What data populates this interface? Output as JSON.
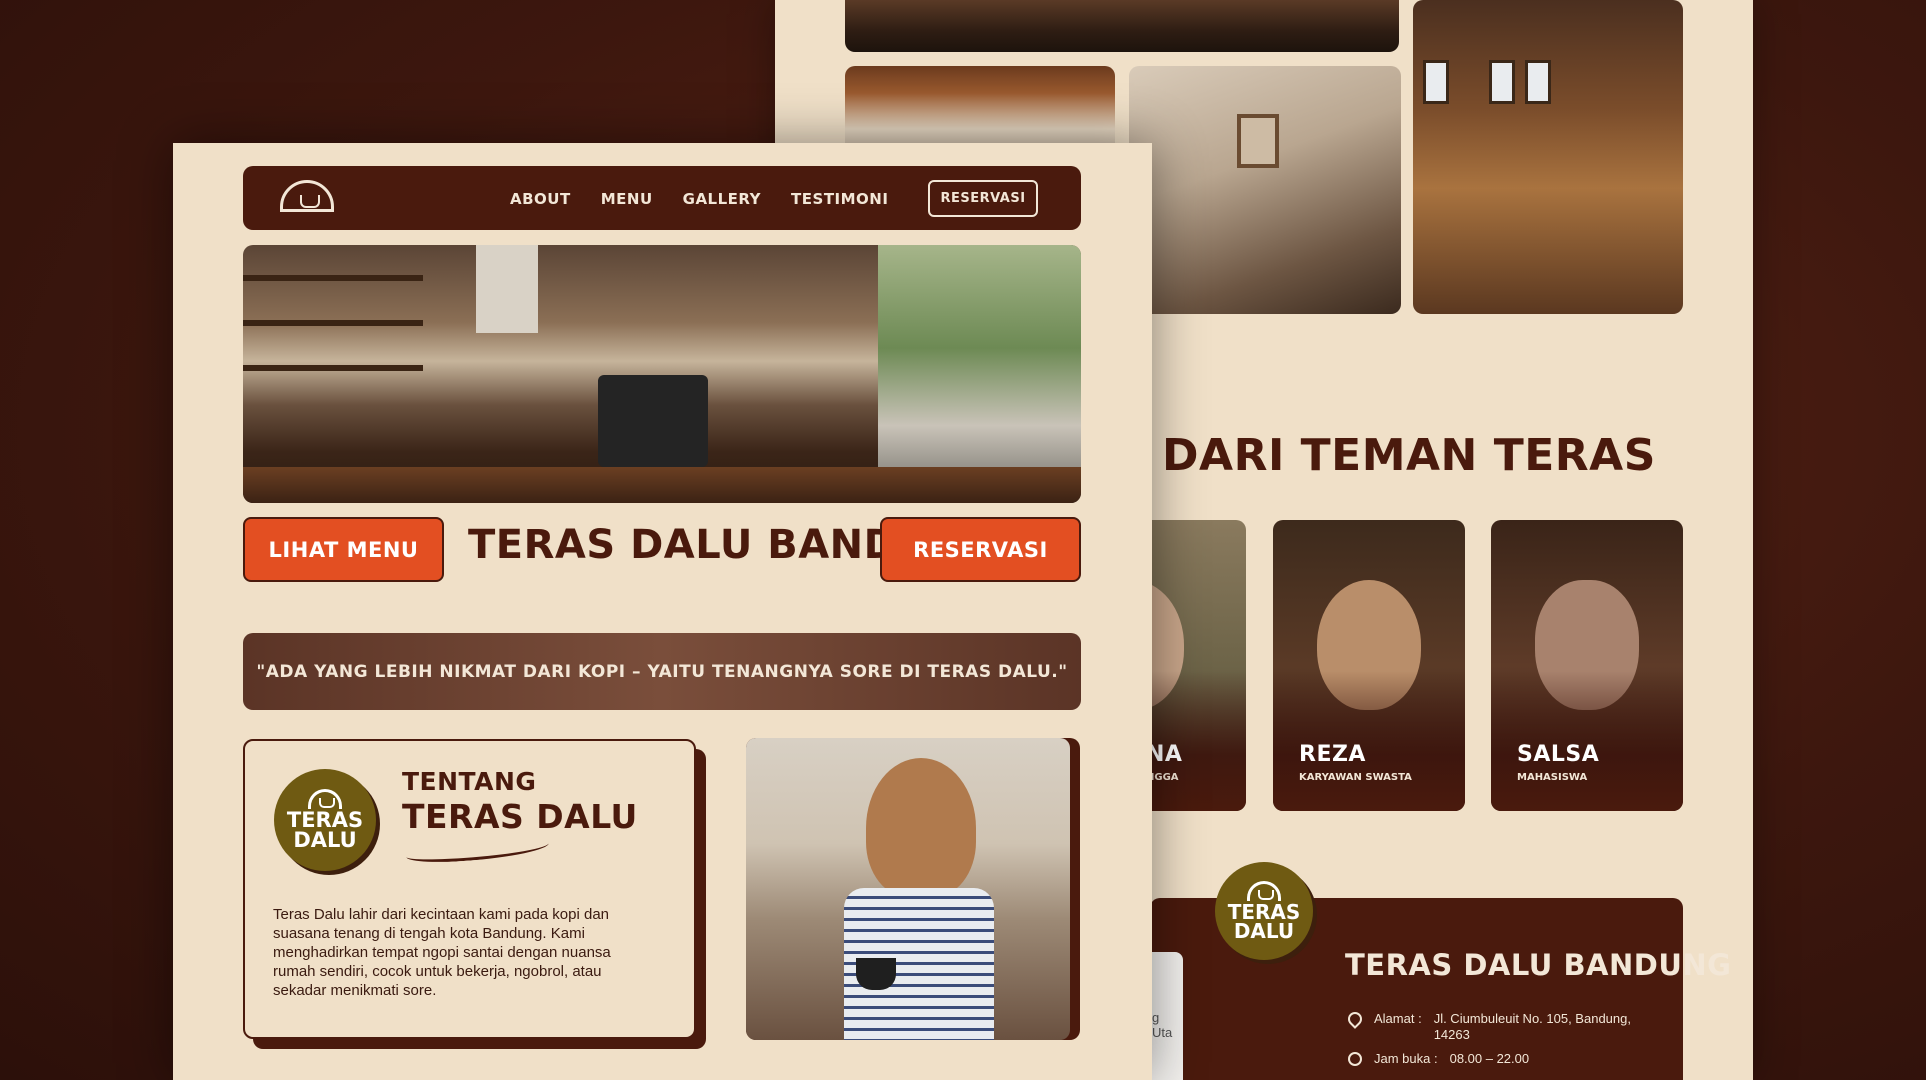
{
  "colors": {
    "brand_brown": "#4a1a0d",
    "cream": "#f0e0c8",
    "accent_orange": "#e34f22",
    "badge_olive": "#6f5a12",
    "background": "#3d170e"
  },
  "nav": {
    "logo_icon": "coffee-cup-arc-icon",
    "links": [
      "ABOUT",
      "MENU",
      "GALLERY",
      "TESTIMONI"
    ],
    "cta": "RESERVASI"
  },
  "hero": {
    "btn_menu": "LIHAT MENU",
    "title": "TERAS DALU BANDUNG",
    "btn_reserve": "RESERVASI"
  },
  "quote": "\"ADA YANG LEBIH NIKMAT DARI KOPI – YAITU TENANGNYA SORE DI TERAS DALU.\"",
  "about": {
    "badge_line1": "TERAS",
    "badge_line2": "DALU",
    "heading_small": "TENTANG",
    "heading_large": "TERAS DALU",
    "body": "Teras Dalu lahir dari kecintaan kami pada kopi dan suasana tenang di tengah kota Bandung. Kami menghadirkan tempat ngopi santai dengan nuansa rumah sendiri, cocok untuk bekerja, ngobrol, atau sekadar menikmati sore."
  },
  "testimonials": {
    "title_partial": "DARI TEMAN TERAS",
    "cards": [
      {
        "name": "NA",
        "role": "NGGA"
      },
      {
        "name": "REZA",
        "role": "KARYAWAN SWASTA"
      },
      {
        "name": "SALSA",
        "role": "MAHASISWA"
      }
    ]
  },
  "footer": {
    "badge_line1": "TERAS",
    "badge_line2": "DALU",
    "title": "TERAS DALU BANDUNG",
    "map_label": "g Uta",
    "address_label": "Alamat :",
    "address_value": "Jl. Ciumbuleuit No. 105, Bandung, 14263",
    "hours_label": "Jam buka :",
    "hours_value": "08.00 – 22.00",
    "address_icon": "location-pin-icon",
    "hours_icon": "clock-icon"
  }
}
